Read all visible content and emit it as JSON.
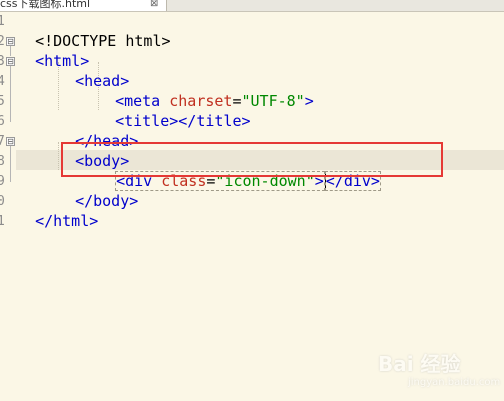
{
  "tab": {
    "title": "css下载图标.html",
    "close_glyph": "⊠"
  },
  "line_numbers": [
    "1",
    "2",
    "3",
    "4",
    "5",
    "6",
    "7",
    "8",
    "9",
    "0",
    "1"
  ],
  "fold_markers": {
    "open": "⊟"
  },
  "code": {
    "l1": {
      "a": "<!DOCTYPE html>"
    },
    "l2": {
      "a": "<html>"
    },
    "l3": {
      "a": "<head>"
    },
    "l4": {
      "a": "<meta ",
      "b": "charset",
      "c": "=",
      "d": "\"UTF-8\"",
      "e": ">"
    },
    "l5": {
      "a": "<title></title>"
    },
    "l6": {
      "a": "</head>"
    },
    "l7": {
      "a": "<body>"
    },
    "l8": {
      "a": "<",
      "b": "div ",
      "c": "class",
      "d": "=",
      "e": "\"icon-down\"",
      "f": ">",
      "g": "</div>"
    },
    "l9": {
      "a": "</body>"
    },
    "l10": {
      "a": "</html>"
    }
  },
  "colors": {
    "background": "#fbf7e6",
    "current_line": "#ebe6d6",
    "tag": "#0000cc",
    "attribute": "#c03020",
    "value": "#008800",
    "highlight_box": "#e53935"
  },
  "watermark": {
    "brand": "Bai 经验",
    "url": "jingyan.baidu.com"
  }
}
